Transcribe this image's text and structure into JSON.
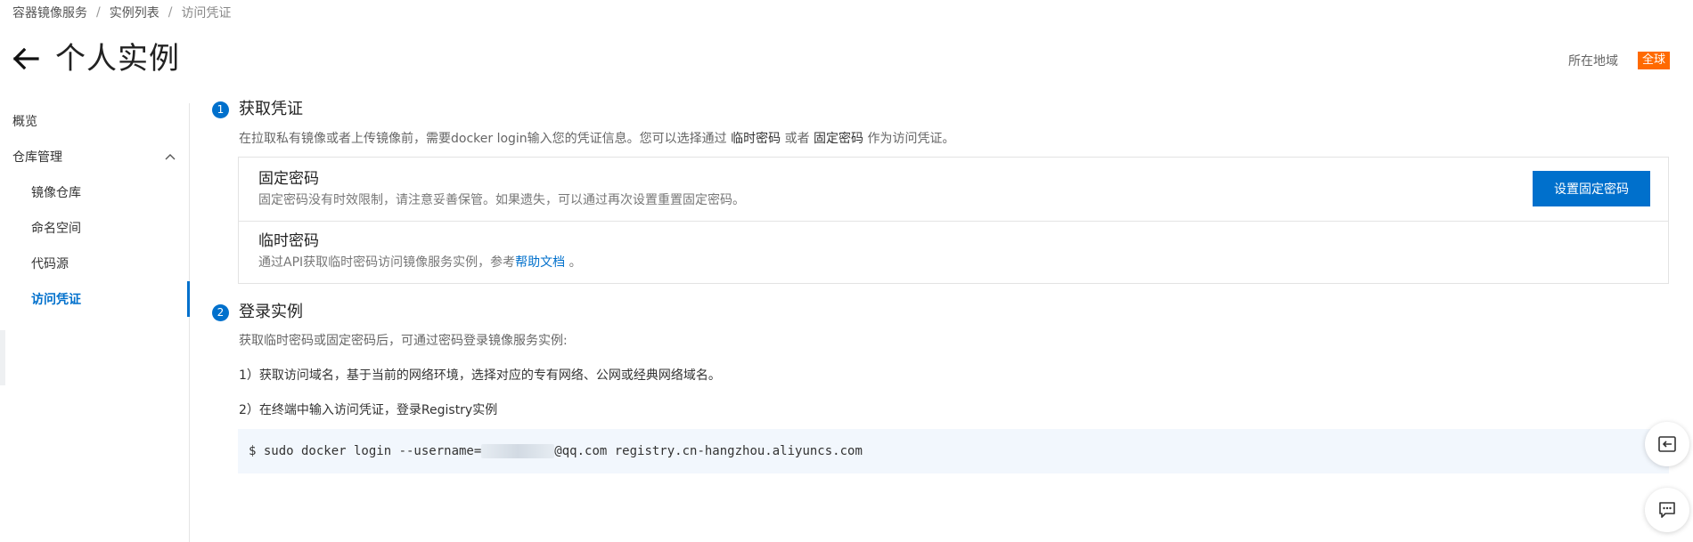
{
  "breadcrumb": {
    "items": [
      "容器镜像服务",
      "实例列表",
      "访问凭证"
    ],
    "separator": "/"
  },
  "header": {
    "back_icon": "arrow-left-icon",
    "title": "个人实例",
    "region_label": "所在地域",
    "region_value": "全球"
  },
  "sidebar": {
    "overview": "概览",
    "group": "仓库管理",
    "items": [
      "镜像仓库",
      "命名空间",
      "代码源",
      "访问凭证"
    ],
    "active": "访问凭证"
  },
  "step1": {
    "number": "1",
    "title": "获取凭证",
    "desc_before": "在拉取私有镜像或者上传镜像前，需要docker login输入您的凭证信息。您可以选择通过 ",
    "desc_temp": "临时密码",
    "desc_mid": " 或者 ",
    "desc_fixed": "固定密码",
    "desc_after": " 作为访问凭证。"
  },
  "fixed_password": {
    "title": "固定密码",
    "desc": "固定密码没有时效限制，请注意妥善保管。如果遗失，可以通过再次设置重置固定密码。",
    "button": "设置固定密码"
  },
  "temp_password": {
    "title": "临时密码",
    "desc": "通过API获取临时密码访问镜像服务实例，参考",
    "link": "帮助文档",
    "desc_end": " 。"
  },
  "step2": {
    "number": "2",
    "title": "登录实例",
    "desc": "获取临时密码或固定密码后，可通过密码登录镜像服务实例:",
    "line1": "1）获取访问域名，基于当前的网络环境，选择对应的专有网络、公网或经典网络域名。",
    "line2": "2）在终端中输入访问凭证，登录Registry实例"
  },
  "code": {
    "prefix": "$ sudo docker login --username=",
    "suffix": "@qq.com registry.cn-hangzhou.aliyuncs.com"
  },
  "floating": {
    "icons": [
      "collapse-panel-icon",
      "chat-icon"
    ]
  },
  "colors": {
    "accent": "#0070cc",
    "region_badge": "#ff6a00",
    "code_bg": "#f2f7fd"
  }
}
